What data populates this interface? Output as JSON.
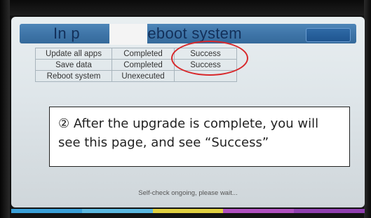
{
  "header": {
    "title": "In p        ss:Reboot system"
  },
  "table": {
    "rows": [
      {
        "task": "Update all apps",
        "status": "Completed",
        "result": "Success"
      },
      {
        "task": "Save data",
        "status": "Completed",
        "result": "Success"
      },
      {
        "task": "Reboot system",
        "status": "Unexecuted",
        "result": ""
      }
    ]
  },
  "callout": {
    "text": "② After the upgrade is complete, you will see this page, and see “Success”"
  },
  "footer": {
    "status": "Self-check ongoing, please wait..."
  },
  "colors": {
    "title_bar": "#3e74a7",
    "highlight_circle": "#d8282b",
    "strip": [
      "#3aa0d8",
      "#5bb8e0",
      "#e0d040",
      "#b050c0",
      "#9040b0"
    ]
  }
}
